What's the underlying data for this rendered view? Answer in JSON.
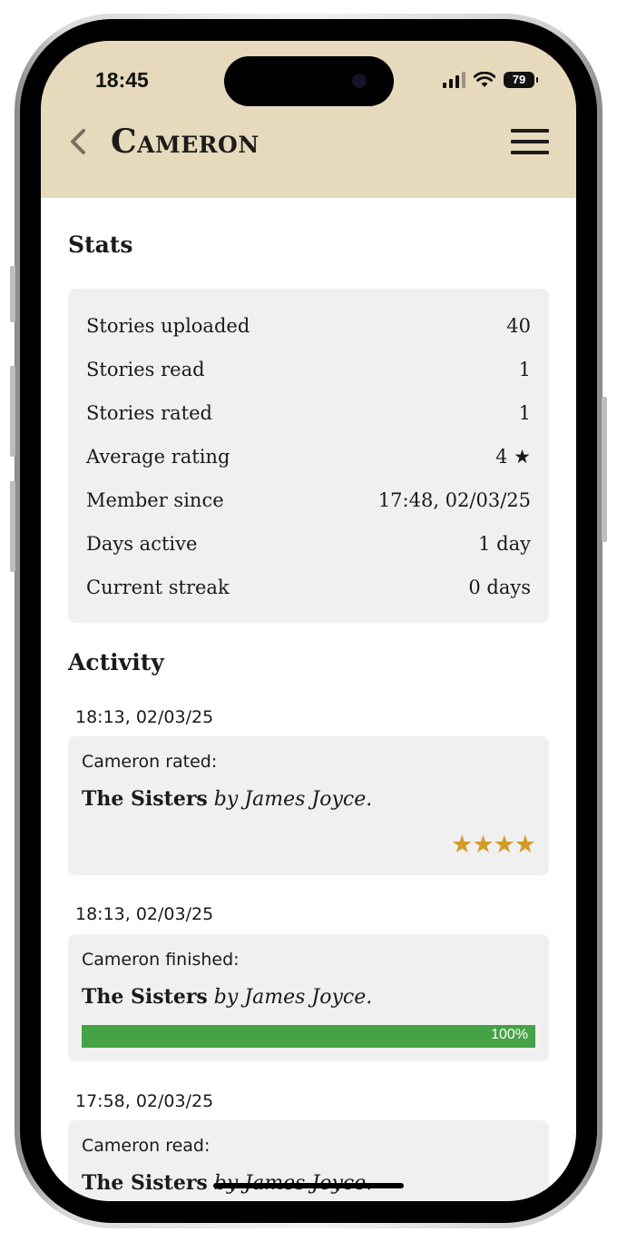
{
  "status_bar": {
    "time": "18:45",
    "battery": "79"
  },
  "header": {
    "title": "Cameron"
  },
  "stats": {
    "heading": "Stats",
    "rows": [
      {
        "label": "Stories uploaded",
        "value": "40"
      },
      {
        "label": "Stories read",
        "value": "1"
      },
      {
        "label": "Stories rated",
        "value": "1"
      },
      {
        "label": "Average rating",
        "value": "4 ★"
      },
      {
        "label": "Member since",
        "value": "17:48, 02/03/25"
      },
      {
        "label": "Days active",
        "value": "1 day"
      },
      {
        "label": "Current streak",
        "value": "0 days"
      }
    ]
  },
  "activity": {
    "heading": "Activity",
    "items": [
      {
        "timestamp": "18:13, 02/03/25",
        "action": "Cameron rated:",
        "title": "The Sisters",
        "by": "by James Joyce.",
        "rating": 4,
        "stars": "★★★★"
      },
      {
        "timestamp": "18:13, 02/03/25",
        "action": "Cameron finished:",
        "title": "The Sisters",
        "by": "by James Joyce.",
        "progress": 100,
        "progress_label": "100%"
      },
      {
        "timestamp": "17:58, 02/03/25",
        "action": "Cameron read:",
        "title": "The Sisters",
        "by": "by James Joyce."
      }
    ]
  },
  "colors": {
    "header_bg": "#e7d9bb",
    "card_bg": "#f0f0f0",
    "star": "#d29a27",
    "progress": "#45a245"
  },
  "icons": {
    "back": "chevron-left-icon",
    "menu": "hamburger-menu-icon",
    "signal": "cellular-signal-icon",
    "wifi": "wifi-icon",
    "battery": "battery-icon"
  }
}
